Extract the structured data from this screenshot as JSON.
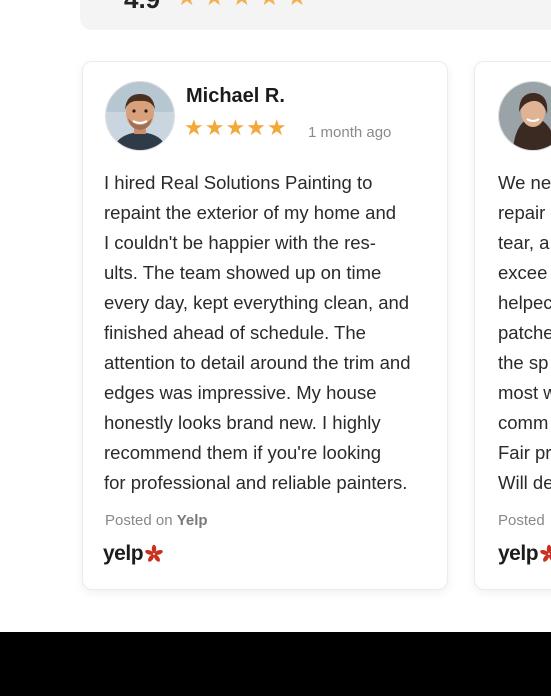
{
  "summary": {
    "rating": "4.9",
    "stars": "★★★★★"
  },
  "reviews": [
    {
      "name": "Michael R.",
      "stars": "★★★★★",
      "date": "1 month ago",
      "lines": [
        "I hired Real Solutions Painting to",
        "repaint the exterior of my home and",
        "I couldn't be happier with the res-",
        "ults. The team showed up on time",
        "every day, kept everything clean, and",
        "finished ahead of schedule. The",
        "attention to detail around the trim and",
        "edges was impressive. My house",
        "honestly looks brand new. I highly",
        "recommend them if you're looking",
        "for professional and reliable painters."
      ],
      "posted_prefix": "Posted on",
      "posted_source": "Yelp",
      "logo_text": "yelp"
    },
    {
      "lines": [
        "We ne",
        "repair",
        "tear, a",
        "excee",
        "helpec",
        "patche",
        "the sp",
        "most w",
        "comm",
        "Fair pr",
        "Will de"
      ],
      "posted_prefix": "Posted",
      "logo_text": "yelp"
    }
  ],
  "colors": {
    "star": "#f2a93b",
    "yelp_red": "#c8311f"
  }
}
